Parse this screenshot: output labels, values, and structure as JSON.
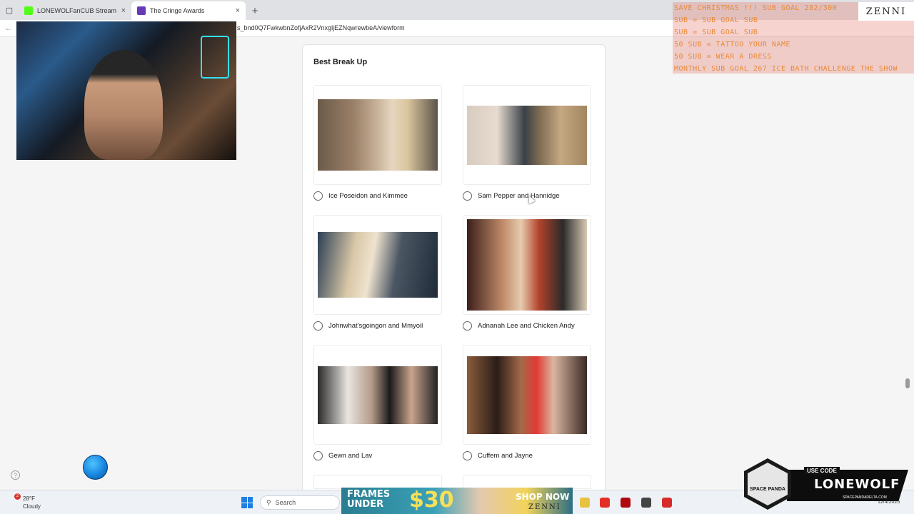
{
  "browser": {
    "tabs": [
      {
        "title": "LONEWOLFanCUB Stream - Watch",
        "favicon_color": "#53fc18"
      },
      {
        "title": "The Cringe Awards",
        "favicon_color": "#673ab7"
      }
    ],
    "url": "s_bnd0Q7FwkwbnZofjAxR2VnxgljEZNqwrewbeA/viewform"
  },
  "form": {
    "question": "Best Break Up",
    "options": [
      {
        "label": "Ice Poseidon and Kimmee"
      },
      {
        "label": "Sam Pepper and Hannidge"
      },
      {
        "label": "Johnwhat'sgoingon and Mmyoil"
      },
      {
        "label": "Adnanah Lee and Chicken Andy"
      },
      {
        "label": "Gewn and Lav"
      },
      {
        "label": "Cuffem and Jayne"
      }
    ]
  },
  "overlay": {
    "goals": [
      "SAVE CHRISTMAS !!! SUB GOAL 282/300",
      " SUB = SUB GOAL SUB",
      " SUB = SUB GOAL SUB",
      "50 SUB = TATTOO YOUR NAME",
      "50 SUB = WEAR A DRESS",
      "MONTHLY SUB GOAL 267 ICE BATH CHALLENGE THE SHOW"
    ],
    "brand_logo": "ZENNI",
    "promo": {
      "tag": "USE CODE",
      "code": "LONEWOLF",
      "site": "SPACEPANDADELTA.COM",
      "badge": "SPACE PANDA"
    }
  },
  "taskbar": {
    "weather_temp": "28°F",
    "weather_desc": "Cloudy",
    "weather_badge": "2",
    "search_placeholder": "Search",
    "date": "12/4/2025"
  },
  "ad": {
    "line1": "FRAMES",
    "line2": "UNDER",
    "number": "$30",
    "cta": "SHOP NOW",
    "brand": "ZENNI"
  }
}
